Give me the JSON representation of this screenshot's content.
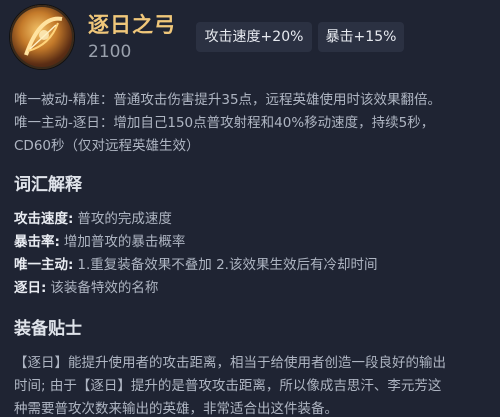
{
  "item": {
    "name": "逐日之弓",
    "price": "2100",
    "icon": "golden-bow-icon",
    "stats": [
      "攻击速度+20%",
      "暴击+15%"
    ]
  },
  "effects": {
    "line1": "唯一被动-精准：普通攻击伤害提升35点，远程英雄使用时该效果翻倍。",
    "line2": "唯一主动-逐日：增加自己150点普攻射程和40%移动速度，持续5秒，",
    "line3": "CD60秒（仅对远程英雄生效）"
  },
  "glossary": {
    "title": "词汇解释",
    "terms": [
      {
        "key": "攻击速度:",
        "value": "普攻的完成速度"
      },
      {
        "key": "暴击率:",
        "value": "增加普攻的暴击概率"
      },
      {
        "key": "唯一主动:",
        "value": "1.重复装备效果不叠加 2.该效果生效后有冷却时间"
      },
      {
        "key": "逐日:",
        "value": "该装备特效的名称"
      }
    ]
  },
  "tips": {
    "title": "装备贴士",
    "lines": [
      "【逐日】能提升使用者的攻击距离，相当于给使用者创造一段良好的输出",
      "时间; 由于【逐日】提升的是普攻攻击距离，所以像成吉思汗、李元芳这",
      "种需要普攻次数来输出的英雄，非常适合出这件装备。"
    ]
  },
  "colors": {
    "background": "#1f2433",
    "item_name": "#f0c77a",
    "badge_bg": "#2b3142"
  }
}
